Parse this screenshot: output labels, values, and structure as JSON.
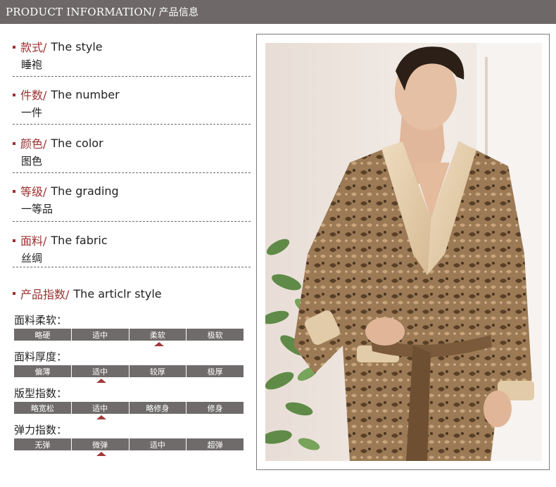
{
  "header": {
    "title_en": "PRODUCT INFORMATION/",
    "title_cn": "产品信息"
  },
  "attributes": [
    {
      "cn": "款式/",
      "en": "The style",
      "value": "睡袍"
    },
    {
      "cn": "件数/",
      "en": "The number",
      "value": "一件"
    },
    {
      "cn": "颜色/",
      "en": "The color",
      "value": "图色"
    },
    {
      "cn": "等级/",
      "en": "The grading",
      "value": "一等品"
    },
    {
      "cn": "面料/",
      "en": "The fabric",
      "value": "丝绸"
    }
  ],
  "index": {
    "cn": "产品指数/",
    "en": "The articlr style",
    "scales": [
      {
        "name": "面料柔软：",
        "options": [
          "略硬",
          "适中",
          "柔软",
          "极软"
        ],
        "selected_index": 2
      },
      {
        "name": "面料厚度：",
        "options": [
          "偏薄",
          "适中",
          "较厚",
          "极厚"
        ],
        "selected_index": 1
      },
      {
        "name": "版型指数：",
        "options": [
          "略宽松",
          "适中",
          "略修身",
          "修身"
        ],
        "selected_index": 1
      },
      {
        "name": "弹力指数：",
        "options": [
          "无弹",
          "微弹",
          "适中",
          "超弹"
        ],
        "selected_index": 1
      }
    ]
  },
  "colors": {
    "accent": "#9a3030",
    "bar": "#6e6968",
    "cell": "#706b6b",
    "marker": "#a33a3a"
  }
}
